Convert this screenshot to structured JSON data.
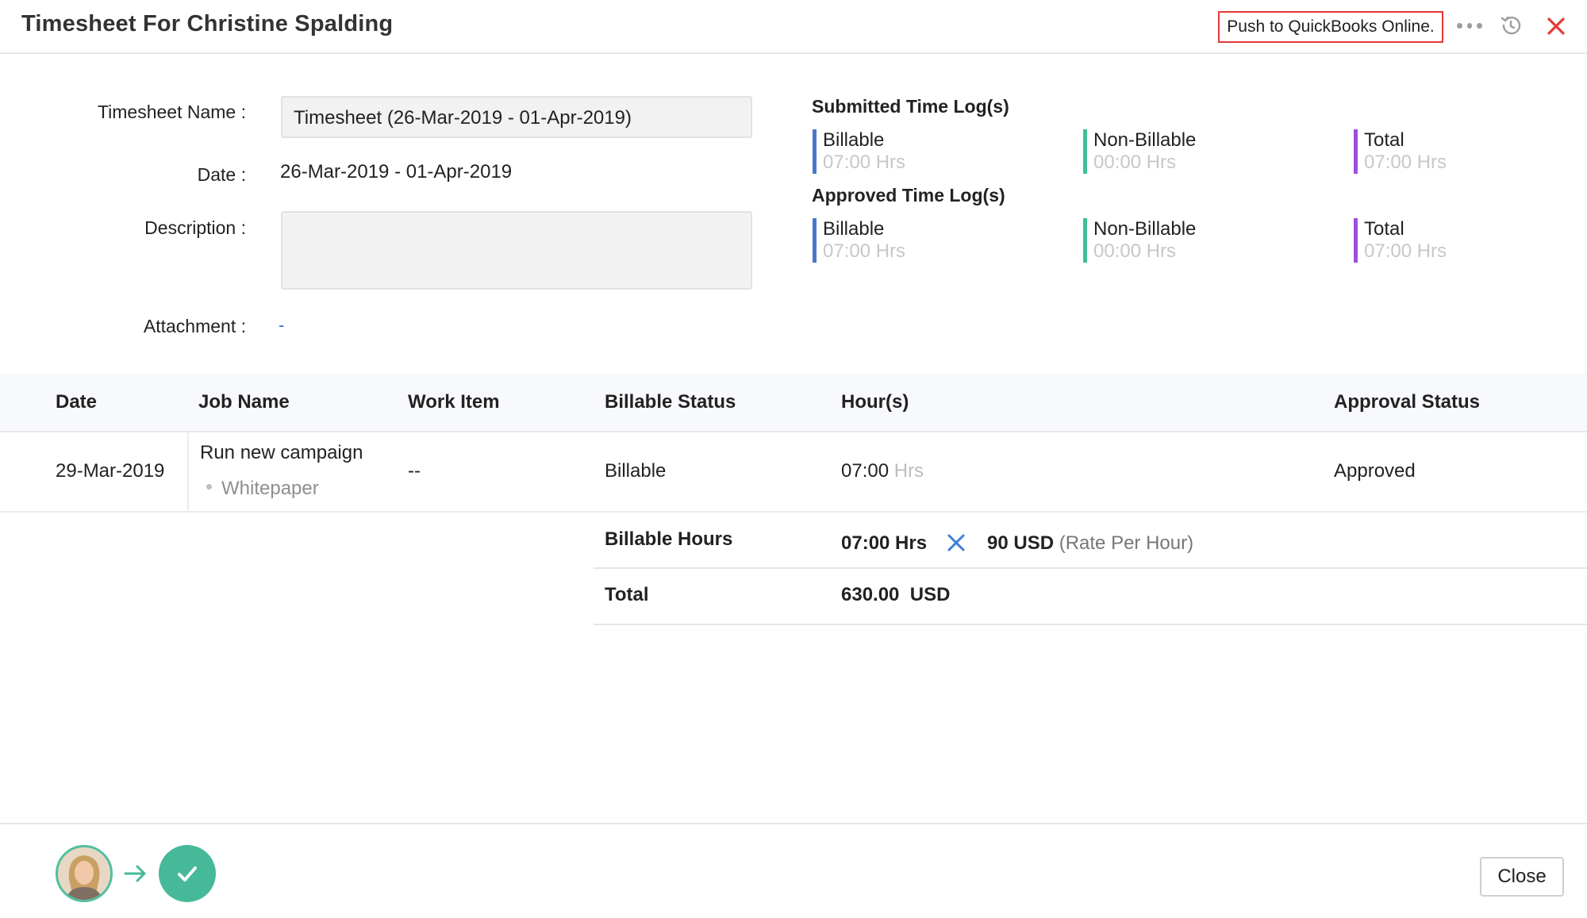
{
  "header": {
    "title": "Timesheet For Christine Spalding",
    "push_button": "Push to QuickBooks Online."
  },
  "form": {
    "name_label": "Timesheet Name :",
    "name_value": "Timesheet (26-Mar-2019 - 01-Apr-2019)",
    "date_label": "Date :",
    "date_value": "26-Mar-2019 - 01-Apr-2019",
    "description_label": "Description :",
    "description_value": "",
    "attachment_label": "Attachment :",
    "attachment_value": "-"
  },
  "submitted": {
    "heading": "Submitted Time Log(s)",
    "billable_label": "Billable",
    "billable_value": "07:00 Hrs",
    "nonbillable_label": "Non-Billable",
    "nonbillable_value": "00:00 Hrs",
    "total_label": "Total",
    "total_value": "07:00 Hrs"
  },
  "approved": {
    "heading": "Approved Time Log(s)",
    "billable_label": "Billable",
    "billable_value": "07:00 Hrs",
    "nonbillable_label": "Non-Billable",
    "nonbillable_value": "00:00 Hrs",
    "total_label": "Total",
    "total_value": "07:00 Hrs"
  },
  "colors": {
    "billable": "#4a78c9",
    "nonbillable": "#3fbf9a",
    "total": "#9b4fe0",
    "accent_red": "#e53935",
    "approved_green": "#46b999"
  },
  "table": {
    "headers": {
      "date": "Date",
      "job": "Job Name",
      "work_item": "Work Item",
      "billable_status": "Billable Status",
      "hours": "Hour(s)",
      "approval": "Approval Status"
    },
    "row": {
      "date": "29-Mar-2019",
      "job": "Run new campaign",
      "task": "Whitepaper",
      "work_item": "--",
      "billable_status": "Billable",
      "hours": "07:00",
      "hours_unit": "Hrs",
      "approval": "Approved"
    }
  },
  "summary": {
    "billable_hours_label": "Billable Hours",
    "billable_hours_value": "07:00 Hrs",
    "rate_value": "90 USD",
    "rate_note": "(Rate Per Hour)",
    "total_label": "Total",
    "total_value": "630.00  USD"
  },
  "footer": {
    "close_button": "Close"
  },
  "icons": {
    "more": "more-icon",
    "history": "history-icon",
    "close": "close-icon",
    "multiply": "multiply-icon",
    "arrow": "arrow-right-icon",
    "check": "check-icon"
  }
}
